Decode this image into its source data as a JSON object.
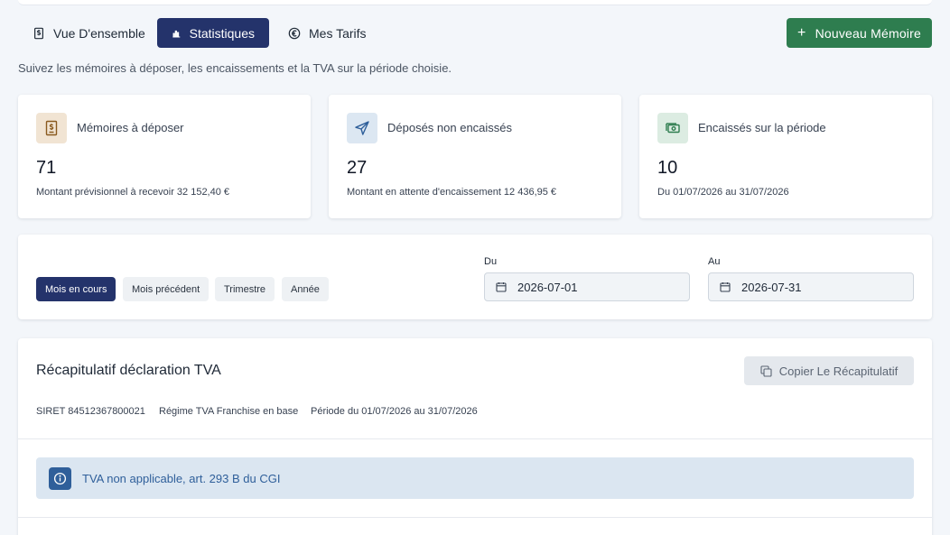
{
  "nav": {
    "tabs": [
      {
        "label": "Vue D'ensemble",
        "icon": "document-dollar-icon"
      },
      {
        "label": "Statistiques",
        "icon": "bar-chart-icon",
        "active": true
      },
      {
        "label": "Mes Tarifs",
        "icon": "euro-icon"
      }
    ],
    "new_button": "Nouveau Mémoire"
  },
  "subtitle": "Suivez les mémoires à déposer, les encaissements et la TVA sur la période choisie.",
  "stats": [
    {
      "label": "Mémoires à déposer",
      "value": "71",
      "foot": "Montant prévisionnel à recevoir 32 152,40 €",
      "icon": "receipt-icon",
      "color": "#f1e4d3"
    },
    {
      "label": "Déposés non encaissés",
      "value": "27",
      "foot": "Montant en attente d'encaissement 12 436,95 €",
      "icon": "send-icon",
      "color": "#dce7f2"
    },
    {
      "label": "Encaissés sur la période",
      "value": "10",
      "foot": "Du 01/07/2026 au 31/07/2026",
      "icon": "banknote-icon",
      "color": "#dcece2"
    }
  ],
  "filters": {
    "chips": [
      "Mois en cours",
      "Mois précédent",
      "Trimestre",
      "Année"
    ],
    "active_chip": "Mois en cours",
    "du_label": "Du",
    "du_value": "2026-07-01",
    "au_label": "Au",
    "au_value": "2026-07-31"
  },
  "recap": {
    "title": "Récapitulatif déclaration TVA",
    "copy_button": "Copier Le Récapitulatif",
    "siret": "SIRET 84512367800021",
    "regime": "Régime TVA Franchise en base",
    "periode": "Période du 01/07/2026 au 31/07/2026",
    "info": "TVA non applicable, art. 293 B du CGI"
  },
  "colors": {
    "primary": "#24336b",
    "success": "#2e7d4f",
    "info": "#2f5f9a"
  }
}
